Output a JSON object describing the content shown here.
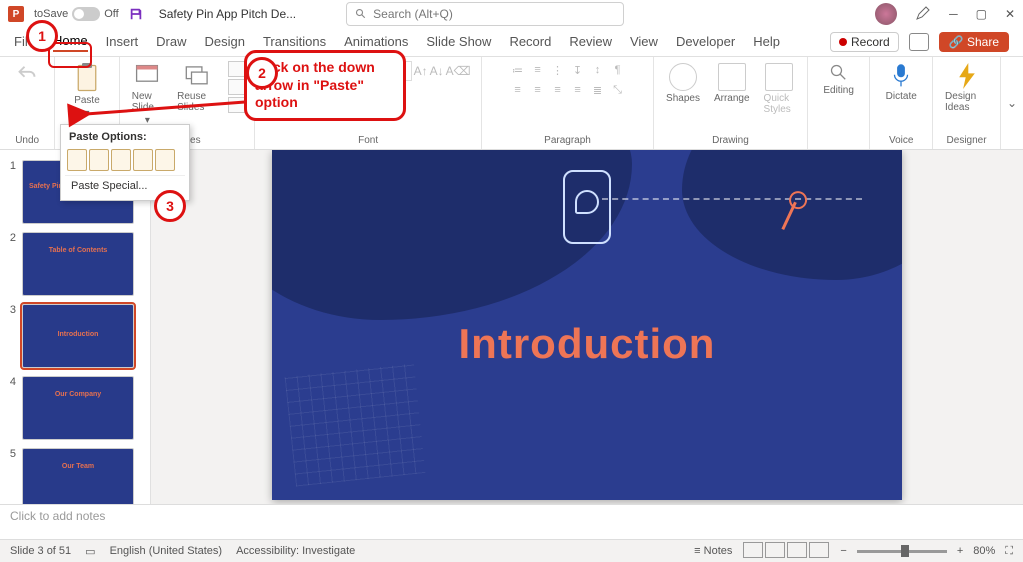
{
  "titlebar": {
    "autosave": "toSave",
    "autosave_state": "Off",
    "doc": "Safety Pin App Pitch De...",
    "search_placeholder": "Search (Alt+Q)"
  },
  "tabs": {
    "items": [
      "File",
      "Home",
      "Insert",
      "Draw",
      "Design",
      "Transitions",
      "Animations",
      "Slide Show",
      "Record",
      "Review",
      "View",
      "Developer",
      "Help"
    ],
    "active": 1,
    "record": "Record",
    "share": "Share"
  },
  "ribbon": {
    "undo": "Undo",
    "clipboard": {
      "paste": "Paste"
    },
    "slides": {
      "new": "New Slide",
      "reuse": "Reuse Slides",
      "label": "Slides"
    },
    "font": {
      "label": "Font",
      "name": "",
      "size": ""
    },
    "paragraph": {
      "label": "Paragraph"
    },
    "drawing": {
      "shapes": "Shapes",
      "arrange": "Arrange",
      "quick": "Quick Styles",
      "label": "Drawing"
    },
    "editing": {
      "label": "Editing",
      "btn": "Editing"
    },
    "voice": {
      "dictate": "Dictate",
      "label": "Voice"
    },
    "designer": {
      "ideas": "Design Ideas",
      "label": "Designer"
    }
  },
  "paste_popup": {
    "header": "Paste Options:",
    "special": "Paste Special..."
  },
  "thumbs": [
    {
      "n": "1",
      "title": "Safety Pin Pitch"
    },
    {
      "n": "2",
      "title": "Table of Contents"
    },
    {
      "n": "3",
      "title": "Introduction"
    },
    {
      "n": "4",
      "title": "Our Company"
    },
    {
      "n": "5",
      "title": "Our Team"
    }
  ],
  "slide": {
    "title": "Introduction"
  },
  "notes": {
    "placeholder": "Click to add notes"
  },
  "status": {
    "slide": "Slide 3 of 51",
    "lang": "English (United States)",
    "access": "Accessibility: Investigate",
    "notes": "Notes",
    "zoom": "80%"
  },
  "annot": {
    "n1": "1",
    "n2": "2",
    "n3": "3",
    "callout": "Click on the down arrow in \"Paste\" option"
  }
}
